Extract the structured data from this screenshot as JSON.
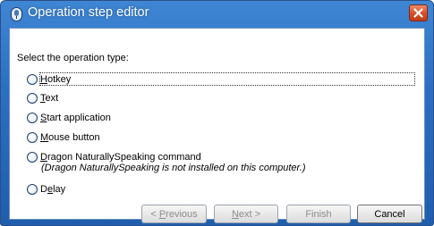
{
  "window": {
    "title": "Operation step editor",
    "title_icon": "app-icon",
    "close_icon": "close-icon",
    "title_color": "#2a6fc2",
    "close_color": "#d8502b"
  },
  "prompt": "Select the operation type:",
  "options": [
    {
      "pre": "",
      "mnemonic": "H",
      "post": "otkey",
      "selected": false
    },
    {
      "pre": "",
      "mnemonic": "T",
      "post": "ext",
      "selected": false
    },
    {
      "pre": "",
      "mnemonic": "S",
      "post": "tart application",
      "selected": false
    },
    {
      "pre": "",
      "mnemonic": "M",
      "post": "ouse button",
      "selected": false
    },
    {
      "pre": "",
      "mnemonic": "D",
      "post": "ragon NaturallySpeaking command",
      "selected": false
    },
    {
      "pre": "D",
      "mnemonic": "e",
      "post": "lay",
      "selected": false
    }
  ],
  "dragon_note": "(Dragon NaturallySpeaking is not installed on this computer.)",
  "buttons": {
    "previous": {
      "pre": "< ",
      "mnemonic": "P",
      "post": "revious"
    },
    "next": {
      "pre": "",
      "mnemonic": "N",
      "post": "ext >"
    },
    "finish": "Finish",
    "cancel": "Cancel"
  }
}
